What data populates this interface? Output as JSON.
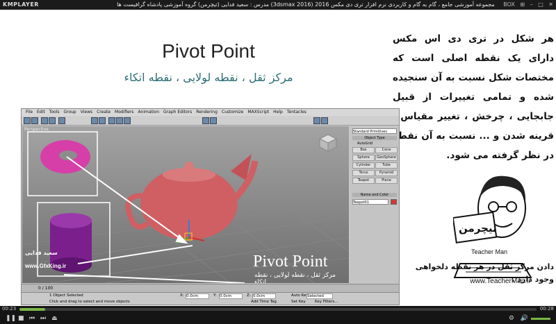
{
  "player": {
    "logo": "KMPLAYER",
    "title": "مجموعه آموزشی جامع ، گام به گام و کاربردی نرم افزار تری دی مکس 2016 (3dsmax 2016) مدرس : سعید فدایی (تیچرمن) گروه آموزشی پادشاه گرافیست ها",
    "box_label": "BOX",
    "current_time": "00:23",
    "end_time": "00:28",
    "progress": 0.05
  },
  "slide": {
    "title": "Pivot Point",
    "subtitle": "مرکز ثقل ، نقطه لولایی ، نقطه اتکاء",
    "paragraph": "هر شکل در تری دی اس مکس دارای یک نقطه اصلی است که مختصات شکل نسبت به آن سنجیده شده و تمامی تغییرات از قبیل جابجایی ، چرخش ، تغییر مقیاس ، قرینه شدن و ... نسبت به آن نقطه در نظر گرفته می شود.",
    "bottom_text": "دادن مرکز ثقل در هر نقطه دلخواهی وجود دارد .",
    "website": "www.TeacherMan.ir",
    "brand": "Teacher Man",
    "logo_fa": "تیچرمن",
    "watermark_site": "www.GfxKing.ir",
    "watermark_name": "سعید فدایی"
  },
  "max": {
    "menu": [
      "File",
      "Edit",
      "Tools",
      "Group",
      "Views",
      "Create",
      "Modifiers",
      "Animation",
      "Graph Editors",
      "Rendering",
      "Customize",
      "MAXScript",
      "Help",
      "Tentacles"
    ],
    "viewport_label": "Perspective",
    "overlay_title": "Pivot Point",
    "overlay_subtitle": "مرکز ثقل ، نقطه لولایی ، نقطه اتکاء",
    "panel": {
      "dropdown": "Standard Primitives",
      "rollout_object_type": "Object Type",
      "autogrid": "AutoGrid",
      "buttons": [
        "Box",
        "Cone",
        "Sphere",
        "GeoSphere",
        "Cylinder",
        "Tube",
        "Torus",
        "Pyramid",
        "Teapot",
        "Plane"
      ],
      "rollout_name_color": "Name and Color",
      "name_value": "Teapot01"
    },
    "timeline": "0 / 100",
    "status1": "1 Object Selected",
    "status2": "Click and drag to select and move objects",
    "x_value": "0.0cm",
    "y_value": "0.0cm",
    "z_value": "0.0cm",
    "autokey": "Auto Key",
    "selected": "Selected",
    "setkey": "Set Key",
    "keyfilters": "Key Filters...",
    "addtimetag": "Add Time Tag"
  },
  "colors": {
    "torus": "#d63fa8",
    "cylinder": "#7a1f8c",
    "teapot": "#cf5f63",
    "accent": "#2a6d74"
  }
}
